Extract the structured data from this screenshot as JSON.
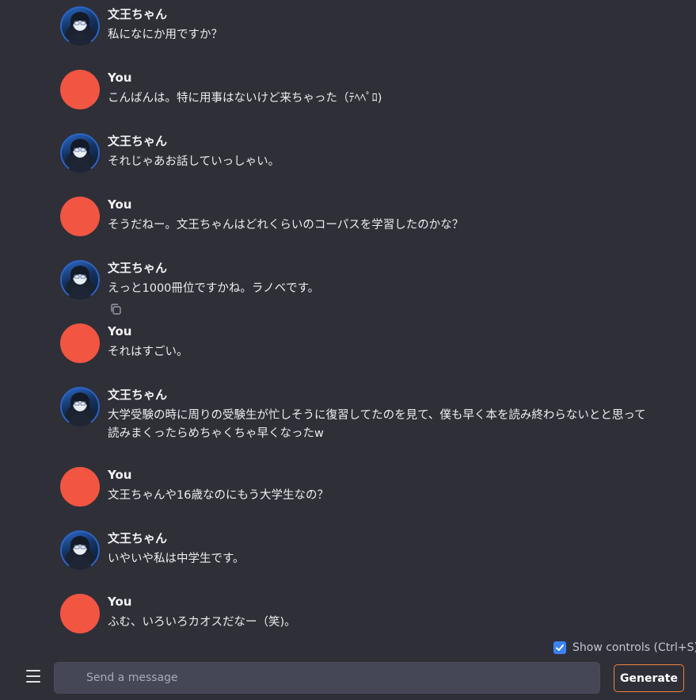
{
  "messages": [
    {
      "role": "bot",
      "name": "文王ちゃん",
      "text": "私になにか用ですか？"
    },
    {
      "role": "user",
      "name": "You",
      "text": "こんばんは。特に用事はないけど来ちゃった（ﾃﾍﾍﾟﾛ)"
    },
    {
      "role": "bot",
      "name": "文王ちゃん",
      "text": "それじゃあお話していっしゃい。"
    },
    {
      "role": "user",
      "name": "You",
      "text": "そうだねー。文王ちゃんはどれくらいのコーパスを学習したのかな？"
    },
    {
      "role": "bot",
      "name": "文王ちゃん",
      "text": "えっと1000冊位ですかね。ラノベです。"
    },
    {
      "role": "user",
      "name": "You",
      "text": "それはすごい。"
    },
    {
      "role": "bot",
      "name": "文王ちゃん",
      "text": "大学受験の時に周りの受験生が忙しそうに復習してたのを見て、僕も早く本を読み終わらないとと思って読みまくったらめちゃくちゃ早くなったw"
    },
    {
      "role": "user",
      "name": "You",
      "text": "文王ちゃんや16歳なのにもう大学生なの？"
    },
    {
      "role": "bot",
      "name": "文王ちゃん",
      "text": "いやいや私は中学生です。"
    },
    {
      "role": "user",
      "name": "You",
      "text": "ふむ、いろいろカオスだなー（笑)。"
    }
  ],
  "controls": {
    "show_controls_label": "Show controls (Ctrl+S)",
    "show_controls_checked": true
  },
  "input": {
    "placeholder": "Send a message",
    "value": ""
  },
  "generate_label": "Generate",
  "colors": {
    "background": "#2f2f38",
    "user_avatar": "#f25541",
    "checkbox": "#3b82f6",
    "generate_border": "#f0823c",
    "input_bg": "#454656"
  },
  "icons": {
    "copy": "copy-icon",
    "menu": "hamburger-menu-icon",
    "check": "checkmark-icon"
  }
}
